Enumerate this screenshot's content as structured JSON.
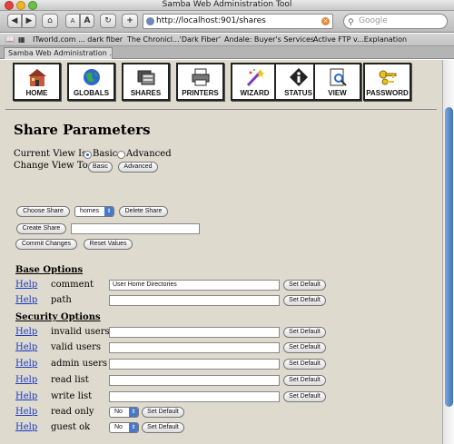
{
  "window": {
    "title": "Samba Web Administration Tool"
  },
  "toolbar": {
    "back": "◀",
    "forward": "▶",
    "home": "⌂",
    "text_smaller": "A",
    "text_bigger": "A",
    "reload": "↻",
    "add": "+",
    "url": "http://localhost:901/shares",
    "search_placeholder": "Google"
  },
  "bookmarks": [
    "ITworld.com ... dark fiber",
    "The Chronicl...'Dark Fiber'",
    "Andale: Buyer's Services",
    "Active FTP v...Explanation"
  ],
  "tab": {
    "label": "Samba Web Administration ..."
  },
  "nav": [
    {
      "label": "HOME",
      "icon": "home-icon"
    },
    {
      "label": "GLOBALS",
      "icon": "globe-icon"
    },
    {
      "label": "SHARES",
      "icon": "shares-icon"
    },
    {
      "label": "PRINTERS",
      "icon": "printer-icon"
    },
    {
      "label": "WIZARD",
      "icon": "wizard-icon"
    },
    {
      "label": "STATUS",
      "icon": "status-icon"
    },
    {
      "label": "VIEW",
      "icon": "view-icon"
    },
    {
      "label": "PASSWORD",
      "icon": "key-icon"
    }
  ],
  "page": {
    "heading": "Share Parameters",
    "current_view_label": "Current View Is:",
    "view_basic": "Basic",
    "view_advanced": "Advanced",
    "change_view_label": "Change View To:",
    "change_basic": "Basic",
    "change_advanced": "Advanced"
  },
  "share_controls": {
    "choose_share": "Choose Share",
    "share_value": "homes",
    "delete_share": "Delete Share",
    "create_share": "Create Share",
    "commit": "Commit Changes",
    "reset": "Reset Values"
  },
  "base_options": {
    "title": "Base Options",
    "rows": [
      {
        "help": "Help",
        "label": "comment",
        "value": "User Home Directories",
        "default": "Set Default"
      },
      {
        "help": "Help",
        "label": "path",
        "value": "",
        "default": "Set Default"
      }
    ]
  },
  "security_options": {
    "title": "Security Options",
    "rows": [
      {
        "help": "Help",
        "label": "invalid users",
        "value": "",
        "default": "Set Default"
      },
      {
        "help": "Help",
        "label": "valid users",
        "value": "",
        "default": "Set Default"
      },
      {
        "help": "Help",
        "label": "admin users",
        "value": "",
        "default": "Set Default"
      },
      {
        "help": "Help",
        "label": "read list",
        "value": "",
        "default": "Set Default"
      },
      {
        "help": "Help",
        "label": "write list",
        "value": "",
        "default": "Set Default"
      },
      {
        "help": "Help",
        "label": "read only",
        "value": "No",
        "default": "Set Default"
      },
      {
        "help": "Help",
        "label": "guest ok",
        "value": "No",
        "default": "Set Default"
      }
    ]
  },
  "colors": {
    "page_bg": "#dedace",
    "link": "#1a3ac8",
    "accent": "#4a78c8"
  }
}
